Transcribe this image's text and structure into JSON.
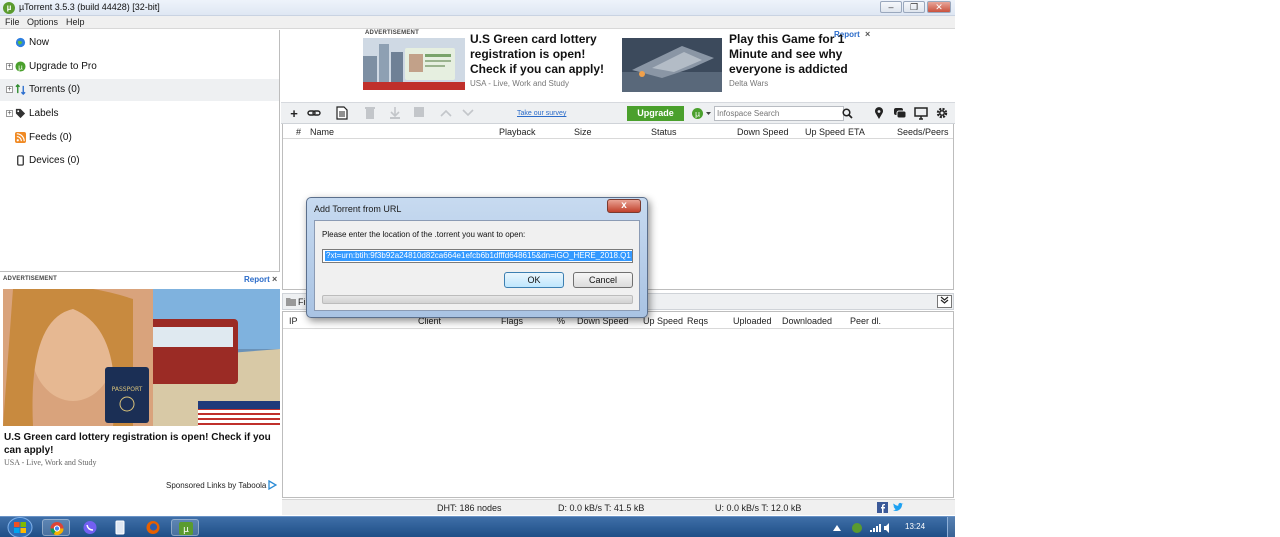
{
  "window": {
    "title": "µTorrent 3.5.3  (build 44428) [32-bit]"
  },
  "menu": [
    "File",
    "Options",
    "Help"
  ],
  "sidebar": {
    "items": [
      {
        "label": "Now",
        "expand": false
      },
      {
        "label": "Upgrade to Pro",
        "expand": true
      },
      {
        "label": "Torrents (0)",
        "expand": true
      },
      {
        "label": "Labels",
        "expand": true
      },
      {
        "label": "Feeds (0)",
        "expand": false
      },
      {
        "label": "Devices (0)",
        "expand": false
      }
    ]
  },
  "top_ad": {
    "label": "ADVERTISEMENT",
    "report": "Report",
    "close": "×",
    "left_headline": [
      "U.S Green card lottery",
      "registration is open!",
      "Check if you can apply!"
    ],
    "left_source": "USA - Live, Work and Study",
    "right_headline": [
      "Play this Game for 1",
      "Minute and see why",
      "everyone is addicted"
    ],
    "right_source": "Delta Wars"
  },
  "toolbar": {
    "survey_link": "Take our survey",
    "upgrade_label": "Upgrade",
    "search_placeholder": "Infospace Search"
  },
  "torrent_columns": [
    "#",
    "Name",
    "Playback",
    "Size",
    "Status",
    "Down Speed",
    "Up Speed",
    "ETA",
    "Seeds/Peers"
  ],
  "peer_tab": "Fi",
  "peer_columns": [
    "IP",
    "Client",
    "Flags",
    "%",
    "Down Speed",
    "Up Speed",
    "Reqs",
    "Uploaded",
    "Downloaded",
    "Peer dl."
  ],
  "status": {
    "dht": "DHT: 186 nodes",
    "down": "D: 0.0 kB/s T: 41.5 kB",
    "up": "U: 0.0 kB/s T: 12.0 kB"
  },
  "left_ad": {
    "label": "ADVERTISEMENT",
    "report": "Report",
    "close": "×",
    "headline": "U.S Green card lottery registration is open! Check if you can apply!",
    "source": "USA - Live, Work and Study",
    "sponsored": "Sponsored Links by Taboola",
    "passport_text": "PASSPORT"
  },
  "dialog": {
    "title": "Add Torrent from URL",
    "close": "x",
    "prompt": "Please enter the location of the .torrent you want to open:",
    "url_value": "?xt=urn:btih:9f3b92a24810d82ca664e1efcb6b1dfffd648615&dn=iGO_HERE_2018.Q1",
    "ok": "OK",
    "cancel": "Cancel"
  },
  "taskbar": {
    "clock": "13:24"
  },
  "colors": {
    "accent_green": "#4aa02c",
    "link_blue": "#2a6bc9",
    "selection_blue": "#3399ff"
  }
}
